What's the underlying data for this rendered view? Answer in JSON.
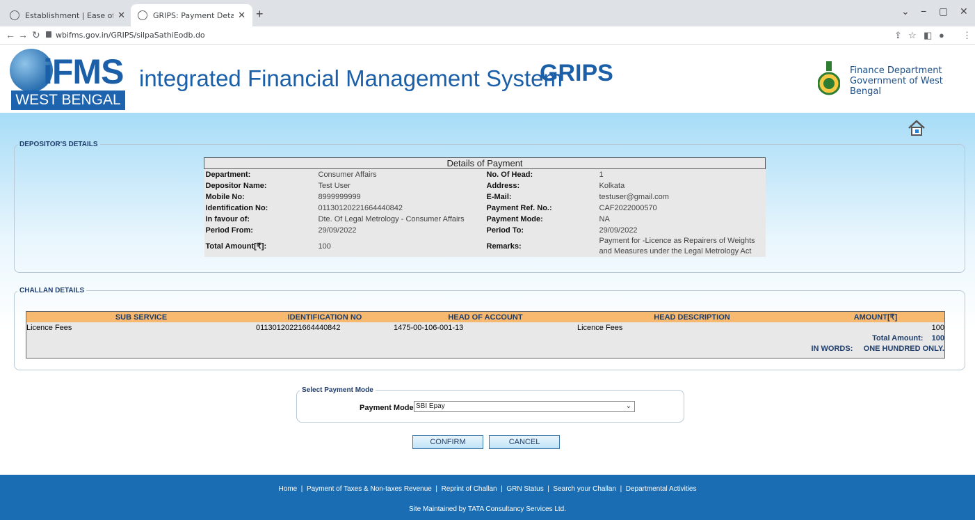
{
  "browser": {
    "tabs": [
      {
        "title": "Establishment | Ease of doing bu"
      },
      {
        "title": "GRIPS: Payment Details"
      }
    ],
    "new_tab": "+",
    "url": "wbifms.gov.in/GRIPS/silpaSathiEodb.do"
  },
  "header": {
    "logo_text": "iFMS",
    "logo_sub": "WEST BENGAL",
    "title": "integrated Financial Management System",
    "grips": "GRIPS",
    "dept_line1": "Finance Department",
    "dept_line2": "Government of West Bengal"
  },
  "depositor": {
    "legend": "DEPOSITOR'S DETAILS",
    "table_title": "Details of Payment",
    "rows": [
      {
        "l1": "Department:",
        "v1": "Consumer Affairs",
        "l2": "No. Of Head:",
        "v2": "1"
      },
      {
        "l1": "Depositor Name:",
        "v1": "Test User",
        "l2": "Address:",
        "v2": "Kolkata"
      },
      {
        "l1": "Mobile No:",
        "v1": "8999999999",
        "l2": "E-Mail:",
        "v2": "testuser@gmail.com"
      },
      {
        "l1": "Identification No:",
        "v1": "01130120221664440842",
        "l2": "Payment Ref. No.:",
        "v2": "CAF2022000570"
      },
      {
        "l1": "In favour of:",
        "v1": "Dte. Of Legal Metrology - Consumer Affairs",
        "l2": "Payment Mode:",
        "v2": "NA"
      },
      {
        "l1": "Period From:",
        "v1": "29/09/2022",
        "l2": "Period To:",
        "v2": "29/09/2022"
      },
      {
        "l1": "Total Amount[₹]:",
        "v1": "100",
        "l2": "Remarks:",
        "v2": "Payment for -Licence as Repairers of Weights and Measures under the Legal Metrology Act"
      }
    ]
  },
  "challan": {
    "legend": "CHALLAN DETAILS",
    "headers": [
      "SUB SERVICE",
      "IDENTIFICATION NO",
      "HEAD OF ACCOUNT",
      "HEAD DESCRIPTION",
      "AMOUNT[₹]"
    ],
    "row": [
      "Licence Fees",
      "01130120221664440842",
      "1475-00-106-001-13",
      "Licence Fees",
      "100"
    ],
    "total_label": "Total Amount:",
    "total_value": "100",
    "words_label": "IN WORDS:",
    "words_value": "ONE HUNDRED ONLY."
  },
  "payment_mode": {
    "legend": "Select Payment Mode",
    "label": "Payment Mode:",
    "selected": "SBI Epay"
  },
  "buttons": {
    "confirm": "CONFIRM",
    "cancel": "CANCEL"
  },
  "footer": {
    "links": [
      "Home",
      "Payment of Taxes & Non-taxes Revenue",
      "Reprint of Challan",
      "GRN Status",
      "Search your Challan",
      "Departmental Activities"
    ],
    "maintained": "Site Maintained by TATA Consultancy Services Ltd."
  }
}
